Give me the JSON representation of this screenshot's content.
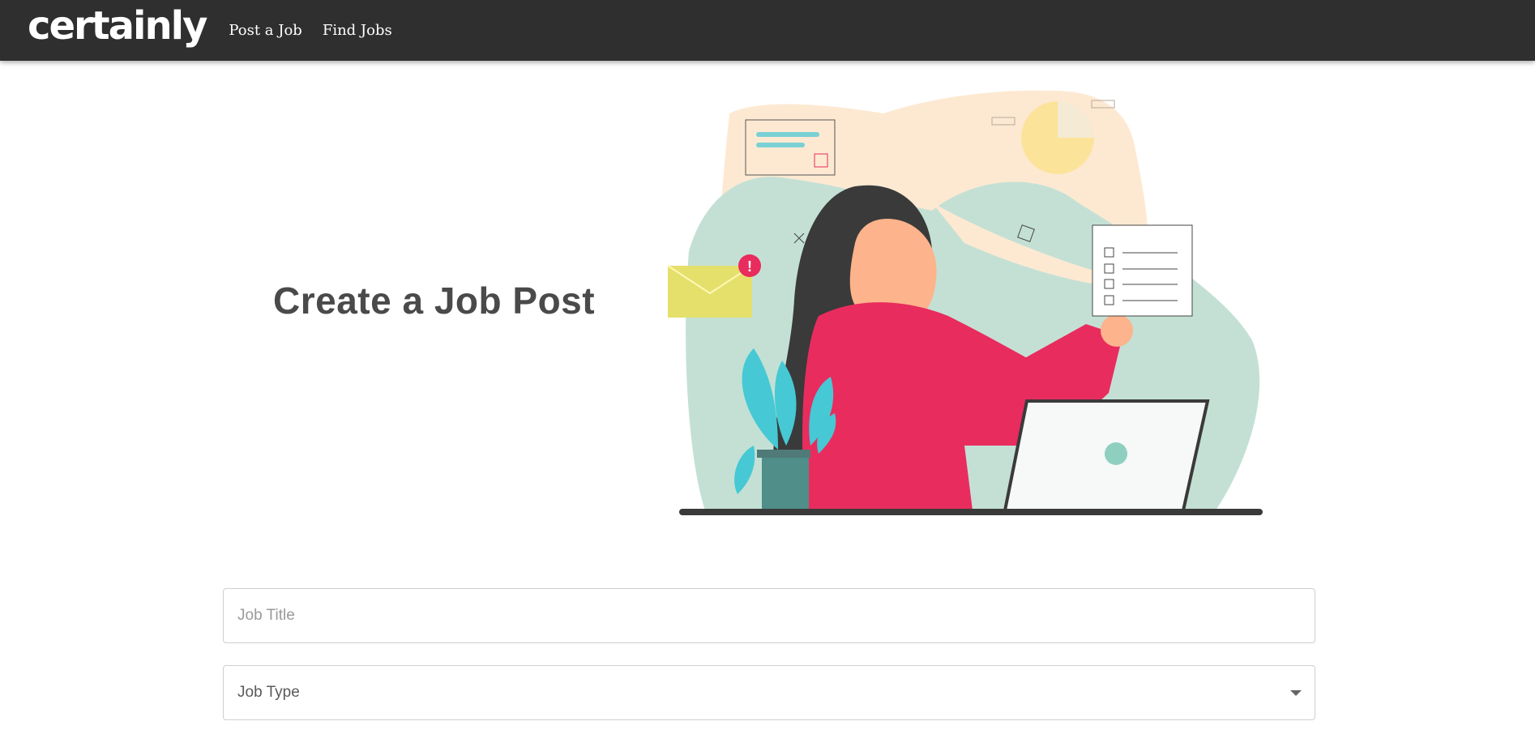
{
  "navbar": {
    "logo": "certainly",
    "links": [
      "Post a Job",
      "Find Jobs"
    ]
  },
  "hero": {
    "title": "Create a Job Post"
  },
  "form": {
    "job_title": {
      "placeholder": "Job Title",
      "value": ""
    },
    "job_type": {
      "label": "Job Type"
    }
  },
  "colors": {
    "navbar": "#2f2f2f",
    "title": "#4a4a4a",
    "accent_pink": "#e82c5e",
    "accent_teal": "#46c9d4",
    "mint": "#c4e0d5",
    "peach": "#fde9d2"
  }
}
